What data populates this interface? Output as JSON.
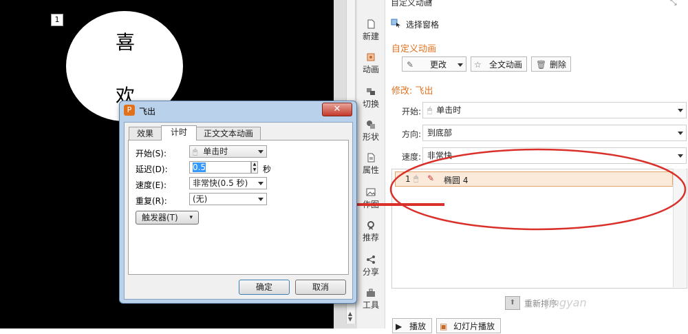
{
  "slide": {
    "number": "1",
    "char_top": "喜",
    "char_bottom": "欢"
  },
  "sidebar": {
    "items": [
      {
        "label": "新建",
        "icon": "document-icon"
      },
      {
        "label": "动画",
        "icon": "animation-icon"
      },
      {
        "label": "切换",
        "icon": "transition-icon"
      },
      {
        "label": "形状",
        "icon": "shape-icon"
      },
      {
        "label": "属性",
        "icon": "properties-icon"
      },
      {
        "label": "作图",
        "icon": "image-icon"
      },
      {
        "label": "推荐",
        "icon": "recommend-icon"
      },
      {
        "label": "分享",
        "icon": "share-icon"
      },
      {
        "label": "工具",
        "icon": "toolbox-icon"
      }
    ]
  },
  "pane": {
    "title": "自定义动画",
    "select_pane": "选择窗格",
    "section_header": "自定义动画",
    "change_btn": "更改",
    "full_text_btn": "全文动画",
    "delete_btn": "删除",
    "modify_header": "修改: 飞出",
    "start_label": "开始:",
    "start_value": "单击时",
    "direction_label": "方向:",
    "direction_value": "到底部",
    "speed_label": "速度:",
    "speed_value": "非常快",
    "list_item_num": "1",
    "list_item_name": "椭圆 4",
    "reorder_label": "重新排序",
    "play_btn": "播放",
    "slideshow_btn": "幻灯片播放",
    "watermark": "jingyan"
  },
  "dialog": {
    "title": "飞出",
    "tabs": [
      "效果",
      "计时",
      "正文文本动画"
    ],
    "start_label": "开始(S):",
    "start_value": "单击时",
    "delay_label": "延迟(D):",
    "delay_value": "0.5",
    "delay_unit": "秒",
    "speed_label": "速度(E):",
    "speed_value": "非常快(0.5 秒)",
    "repeat_label": "重复(R):",
    "repeat_value": "(无)",
    "trigger_btn": "触发器(T)",
    "ok_btn": "确定",
    "cancel_btn": "取消"
  },
  "colors": {
    "accent": "#e2711d",
    "annotation": "#d9302a",
    "dialog_frame": "#b9d1ea"
  }
}
